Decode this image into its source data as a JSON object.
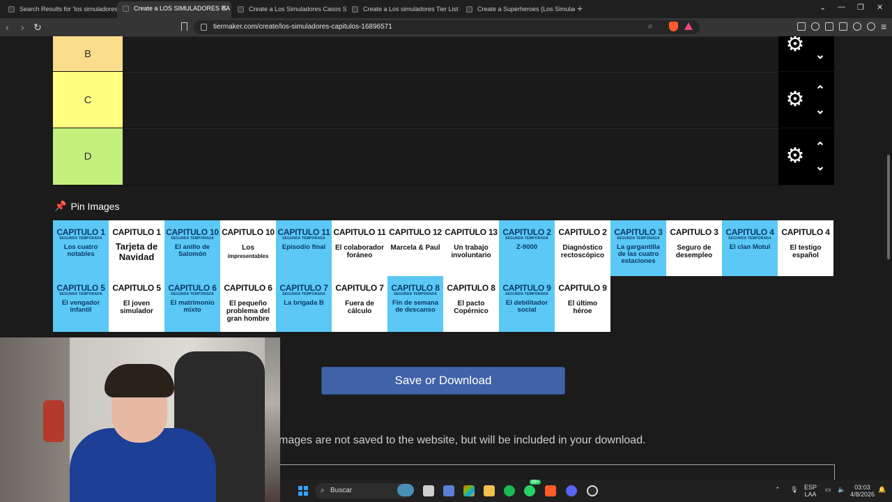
{
  "browser": {
    "tabs": [
      {
        "label": "Search Results for 'los simuladores'",
        "active": false
      },
      {
        "label": "Create a LOS SIMULADORES CA",
        "active": true
      },
      {
        "label": "Create a Los Simuladores Casos Secu",
        "active": false
      },
      {
        "label": "Create a Los simuladores Tier List - T",
        "active": false
      },
      {
        "label": "Create a Superheroes (Los Simulado",
        "active": false
      }
    ],
    "url": "tiermaker.com/create/los-simuladores-capitulos-16896571"
  },
  "tiers": [
    {
      "label": "B",
      "color": "#f9dd8a"
    },
    {
      "label": "C",
      "color": "#ffff80"
    },
    {
      "label": "D",
      "color": "#c6f07e"
    }
  ],
  "pin": {
    "title": "Pin Images"
  },
  "cards": [
    {
      "cap": "CAPITULO 1",
      "season": "SEGUNDA TEMPORADA",
      "sub": "Los cuatro notables",
      "style": "blue"
    },
    {
      "cap": "CAPITULO 1",
      "season": "",
      "sub": "Tarjeta de Navidad",
      "style": "white big"
    },
    {
      "cap": "CAPITULO 10",
      "season": "SEGUNDA TEMPORADA",
      "sub": "El anillo de Salomón",
      "style": "blue"
    },
    {
      "cap": "CAPITULO 10",
      "season": "",
      "sub": "Los",
      "sub2": "impresentables",
      "style": "white"
    },
    {
      "cap": "CAPITULO 11",
      "season": "SEGUNDA TEMPORADA",
      "sub": "Episodio final",
      "style": "blue"
    },
    {
      "cap": "CAPITULO 11",
      "season": "",
      "sub": "El colaborador foráneo",
      "style": "white"
    },
    {
      "cap": "CAPITULO 12",
      "season": "",
      "sub": "Marcela & Paul",
      "style": "white"
    },
    {
      "cap": "CAPITULO 13",
      "season": "",
      "sub": "Un trabajo involuntario",
      "style": "white"
    },
    {
      "cap": "CAPITULO 2",
      "season": "SEGUNDA TEMPORADA",
      "sub": "Z-9000",
      "style": "blue"
    },
    {
      "cap": "CAPITULO 2",
      "season": "",
      "sub": "Diagnóstico rectoscópico",
      "style": "white"
    },
    {
      "cap": "CAPITULO 3",
      "season": "SEGUNDA TEMPORADA",
      "sub": "La gargantilla de las cuatro estaciones",
      "style": "blue"
    },
    {
      "cap": "CAPITULO 3",
      "season": "",
      "sub": "Seguro de desempleo",
      "style": "white"
    },
    {
      "cap": "CAPITULO 4",
      "season": "SEGUNDA TEMPORADA",
      "sub": "El clan Motul",
      "style": "blue"
    },
    {
      "cap": "CAPITULO 4",
      "season": "",
      "sub": "El testigo español",
      "style": "white"
    },
    {
      "cap": "CAPITULO 5",
      "season": "SEGUNDA TEMPORADA",
      "sub": "El vengador infantil",
      "style": "blue"
    },
    {
      "cap": "CAPITULO 5",
      "season": "",
      "sub": "El joven simulador",
      "style": "white"
    },
    {
      "cap": "CAPITULO 6",
      "season": "SEGUNDA TEMPORADA",
      "sub": "El matrimonio mixto",
      "style": "blue"
    },
    {
      "cap": "CAPITULO 6",
      "season": "",
      "sub": "El pequeño problema del gran hombre",
      "style": "white"
    },
    {
      "cap": "CAPITULO 7",
      "season": "SEGUNDA TEMPORADA",
      "sub": "La brigada B",
      "style": "blue"
    },
    {
      "cap": "CAPITULO 7",
      "season": "",
      "sub": "Fuera de cálculo",
      "style": "white"
    },
    {
      "cap": "CAPITULO 8",
      "season": "SEGUNDA TEMPORADA",
      "sub": "Fin de semana de descanso",
      "style": "blue"
    },
    {
      "cap": "CAPITULO 8",
      "season": "",
      "sub": "El pacto Copérnico",
      "style": "white"
    },
    {
      "cap": "CAPITULO 9",
      "season": "SEGUNDA TEMPORADA",
      "sub": "El debilitador social",
      "style": "blue"
    },
    {
      "cap": "CAPITULO 9",
      "season": "",
      "sub": "El último héroe",
      "style": "white"
    }
  ],
  "save": {
    "label": "Save or Download"
  },
  "note": "mages are not saved to the website, but will be included in your download.",
  "taskbar": {
    "search_placeholder": "Buscar",
    "lang_top": "ESP",
    "lang_bottom": "LAA",
    "time": "03:03",
    "date": "4/8/2026",
    "badge": "99+"
  }
}
